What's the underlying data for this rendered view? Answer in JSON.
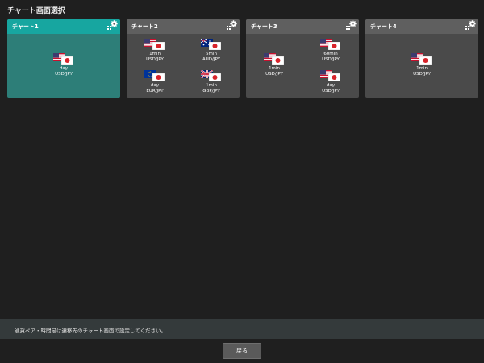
{
  "page": {
    "title": "チャート画面選択"
  },
  "colors": {
    "selected_header": "#17a6a0",
    "selected_body": "#2d7e78",
    "card_header": "#5f5f5f",
    "card_body": "#4a4a4a"
  },
  "cards": [
    {
      "title": "チャート1",
      "selected": true,
      "slots": [
        {
          "period": "day",
          "pair": "USD/JPY",
          "base_flag": "us-flag-icon",
          "quote_flag": "jp-flag-icon"
        }
      ]
    },
    {
      "title": "チャート2",
      "selected": false,
      "slots": [
        {
          "period": "1min",
          "pair": "USD/JPY",
          "base_flag": "us-flag-icon",
          "quote_flag": "jp-flag-icon"
        },
        {
          "period": "5min",
          "pair": "AUD/JPY",
          "base_flag": "au-flag-icon",
          "quote_flag": "jp-flag-icon"
        },
        {
          "period": "day",
          "pair": "EUR/JPY",
          "base_flag": "eu-flag-icon",
          "quote_flag": "jp-flag-icon"
        },
        {
          "period": "1min",
          "pair": "GBP/JPY",
          "base_flag": "gb-flag-icon",
          "quote_flag": "jp-flag-icon"
        }
      ]
    },
    {
      "title": "チャート3",
      "selected": false,
      "slots": [
        {
          "period": "60min",
          "pair": "USD/JPY",
          "base_flag": "us-flag-icon",
          "quote_flag": "jp-flag-icon"
        },
        {
          "period": "1min",
          "pair": "USD/JPY",
          "base_flag": "us-flag-icon",
          "quote_flag": "jp-flag-icon"
        },
        {
          "period": "day",
          "pair": "USD/JPY",
          "base_flag": "us-flag-icon",
          "quote_flag": "jp-flag-icon"
        }
      ]
    },
    {
      "title": "チャート4",
      "selected": false,
      "slots": [
        {
          "period": "1min",
          "pair": "USD/JPY",
          "base_flag": "us-flag-icon",
          "quote_flag": "jp-flag-icon"
        }
      ]
    }
  ],
  "footer": {
    "note": "通貨ペア・時間足は遷移先のチャート画面で設定してください。",
    "back_label": "戻る"
  }
}
